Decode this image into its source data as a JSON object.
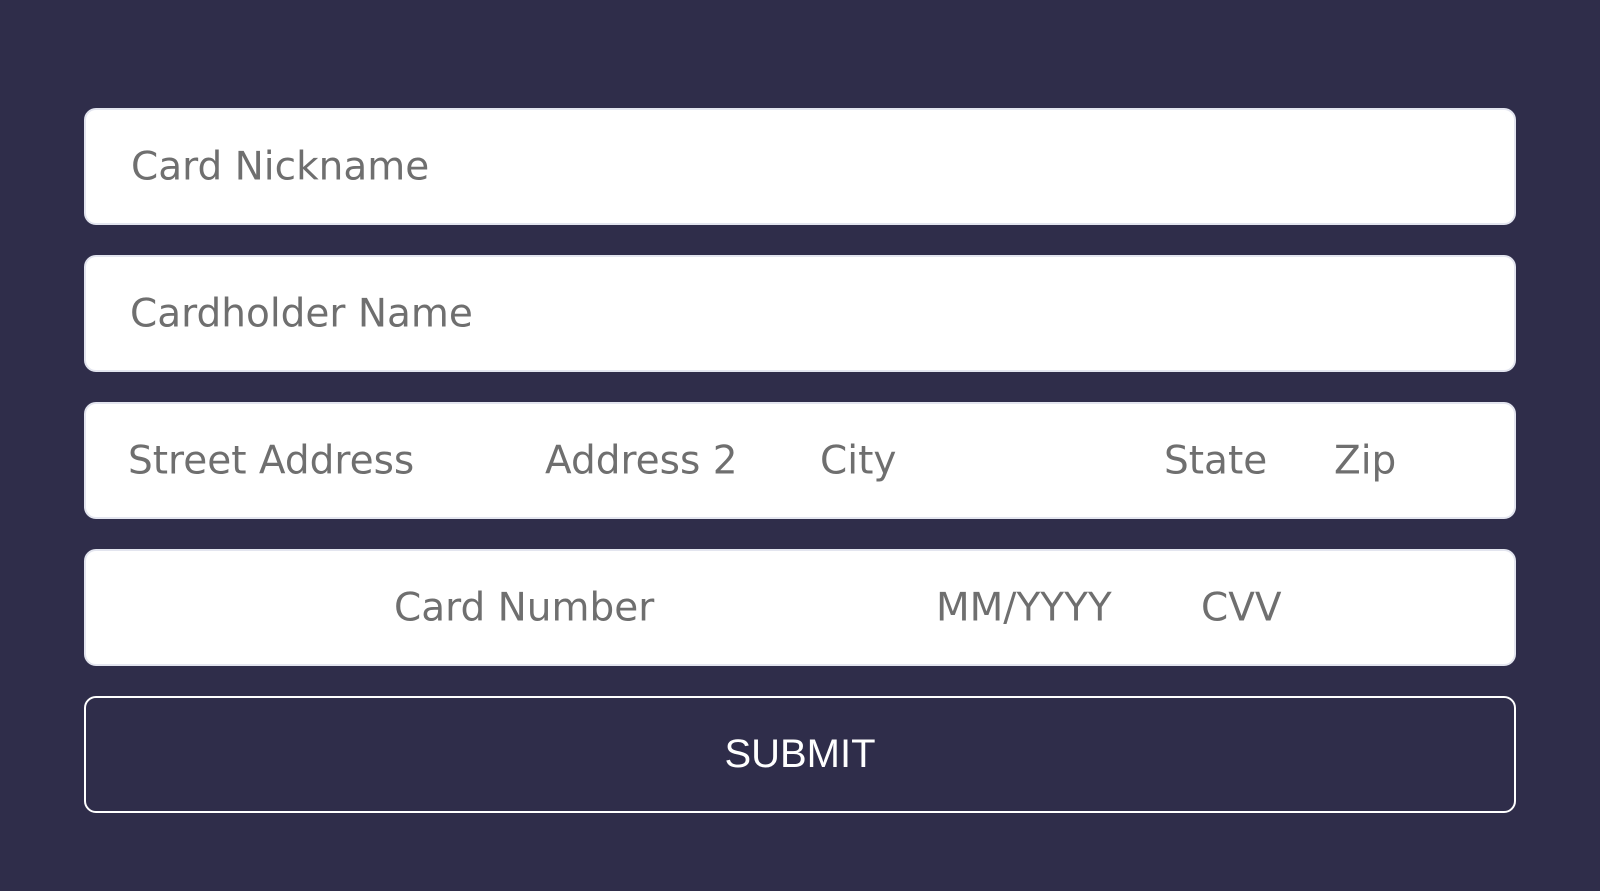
{
  "colors": {
    "background": "#2f2d4a",
    "field_background": "#ffffff",
    "placeholder_text": "#6f6f6f",
    "button_border": "#ffffff",
    "button_text": "#ffffff"
  },
  "form": {
    "card_nickname": {
      "placeholder": "Card Nickname",
      "value": ""
    },
    "cardholder_name": {
      "placeholder": "Cardholder Name",
      "value": ""
    },
    "address": {
      "street": {
        "placeholder": "Street Address",
        "value": ""
      },
      "address2": {
        "placeholder": "Address 2",
        "value": ""
      },
      "city": {
        "placeholder": "City",
        "value": ""
      },
      "state": {
        "placeholder": "State",
        "value": ""
      },
      "zip": {
        "placeholder": "Zip",
        "value": ""
      }
    },
    "card": {
      "number": {
        "placeholder": "Card Number",
        "value": ""
      },
      "expiry": {
        "placeholder": "MM/YYYY",
        "value": ""
      },
      "cvv": {
        "placeholder": "CVV",
        "value": ""
      }
    },
    "submit_label": "SUBMIT"
  }
}
